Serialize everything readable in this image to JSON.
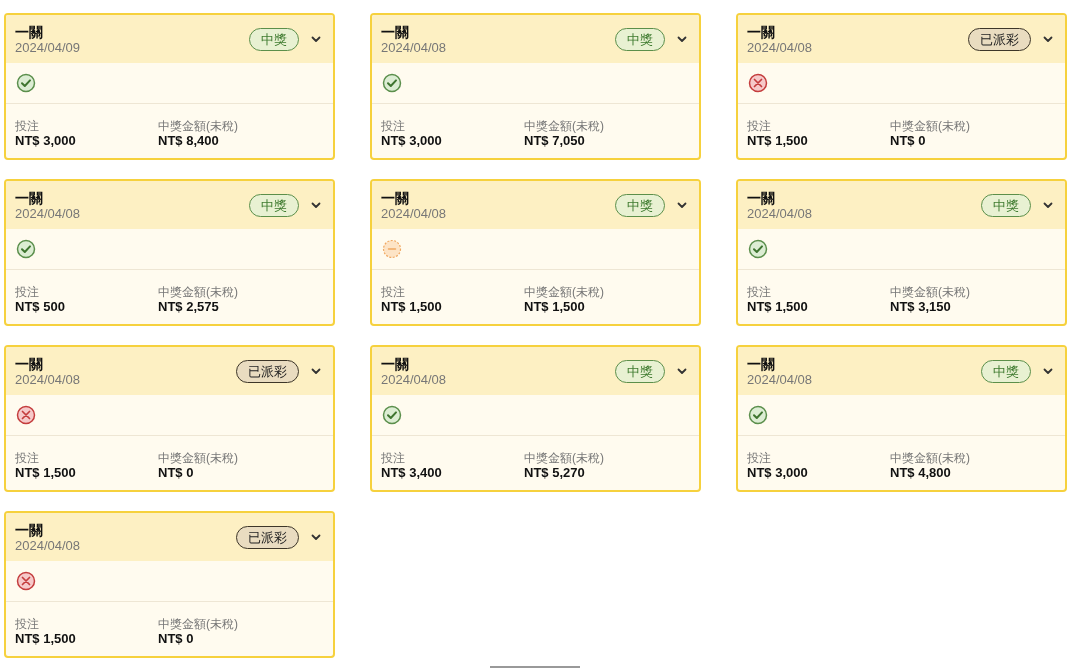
{
  "cards": [
    {
      "title": "一關",
      "date": "2024/04/09",
      "badge": {
        "kind": "won",
        "label": "中獎"
      },
      "result": {
        "kind": "win"
      },
      "stake_label": "投注",
      "stake": "NT$ 3,000",
      "payout_label": "中獎金額(未稅)",
      "payout": "NT$ 8,400"
    },
    {
      "title": "一關",
      "date": "2024/04/08",
      "badge": {
        "kind": "won",
        "label": "中獎"
      },
      "result": {
        "kind": "win"
      },
      "stake_label": "投注",
      "stake": "NT$ 3,000",
      "payout_label": "中獎金額(未稅)",
      "payout": "NT$ 7,050"
    },
    {
      "title": "一關",
      "date": "2024/04/08",
      "badge": {
        "kind": "paid",
        "label": "已派彩"
      },
      "result": {
        "kind": "loss"
      },
      "stake_label": "投注",
      "stake": "NT$ 1,500",
      "payout_label": "中獎金額(未稅)",
      "payout": "NT$ 0"
    },
    {
      "title": "一關",
      "date": "2024/04/08",
      "badge": {
        "kind": "won",
        "label": "中獎"
      },
      "result": {
        "kind": "win"
      },
      "stake_label": "投注",
      "stake": "NT$ 500",
      "payout_label": "中獎金額(未稅)",
      "payout": "NT$ 2,575"
    },
    {
      "title": "一關",
      "date": "2024/04/08",
      "badge": {
        "kind": "won",
        "label": "中獎"
      },
      "result": {
        "kind": "void"
      },
      "stake_label": "投注",
      "stake": "NT$ 1,500",
      "payout_label": "中獎金額(未稅)",
      "payout": "NT$ 1,500"
    },
    {
      "title": "一關",
      "date": "2024/04/08",
      "badge": {
        "kind": "won",
        "label": "中獎"
      },
      "result": {
        "kind": "win"
      },
      "stake_label": "投注",
      "stake": "NT$ 1,500",
      "payout_label": "中獎金額(未稅)",
      "payout": "NT$ 3,150"
    },
    {
      "title": "一關",
      "date": "2024/04/08",
      "badge": {
        "kind": "paid",
        "label": "已派彩"
      },
      "result": {
        "kind": "loss"
      },
      "stake_label": "投注",
      "stake": "NT$ 1,500",
      "payout_label": "中獎金額(未稅)",
      "payout": "NT$ 0"
    },
    {
      "title": "一關",
      "date": "2024/04/08",
      "badge": {
        "kind": "won",
        "label": "中獎"
      },
      "result": {
        "kind": "win"
      },
      "stake_label": "投注",
      "stake": "NT$ 3,400",
      "payout_label": "中獎金額(未稅)",
      "payout": "NT$ 5,270"
    },
    {
      "title": "一關",
      "date": "2024/04/08",
      "badge": {
        "kind": "won",
        "label": "中獎"
      },
      "result": {
        "kind": "win"
      },
      "stake_label": "投注",
      "stake": "NT$ 3,000",
      "payout_label": "中獎金額(未稅)",
      "payout": "NT$ 4,800"
    },
    {
      "title": "一關",
      "date": "2024/04/08",
      "badge": {
        "kind": "paid",
        "label": "已派彩"
      },
      "result": {
        "kind": "loss"
      },
      "stake_label": "投注",
      "stake": "NT$ 1,500",
      "payout_label": "中獎金額(未稅)",
      "payout": "NT$ 0"
    }
  ]
}
